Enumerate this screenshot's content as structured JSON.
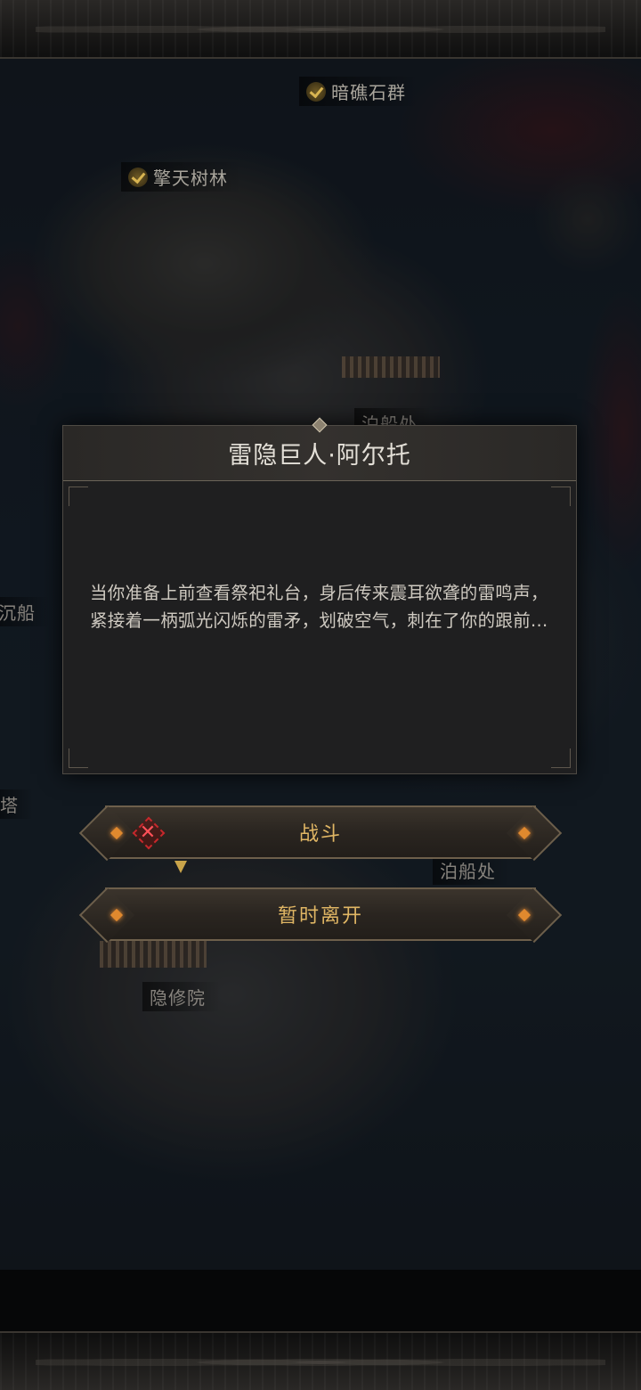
{
  "map": {
    "locations": [
      {
        "name": "暗礁石群",
        "completed": true
      },
      {
        "name": "擎天树林",
        "completed": true
      },
      {
        "name": "泊船处",
        "completed": false
      },
      {
        "name": "沉船",
        "completed": false
      },
      {
        "name": "塔",
        "completed": false
      },
      {
        "name": "泊船处",
        "completed": false
      },
      {
        "name": "隐修院",
        "completed": false
      }
    ]
  },
  "dialog": {
    "title": "雷隐巨人·阿尔托",
    "body": "当你准备上前查看祭祀礼台，身后传来震耳欲聋的雷鸣声，紧接着一柄弧光闪烁的雷矛，划破空气，刺在了你的跟前..."
  },
  "actions": {
    "fight_label": "战斗",
    "leave_label": "暂时离开"
  },
  "colors": {
    "accent_gold": "#e0b664",
    "danger_red": "#c6282c",
    "dialog_bg": "#1f1f20"
  },
  "icons": {
    "completed": "check-icon",
    "danger": "crossed-swords-icon"
  }
}
